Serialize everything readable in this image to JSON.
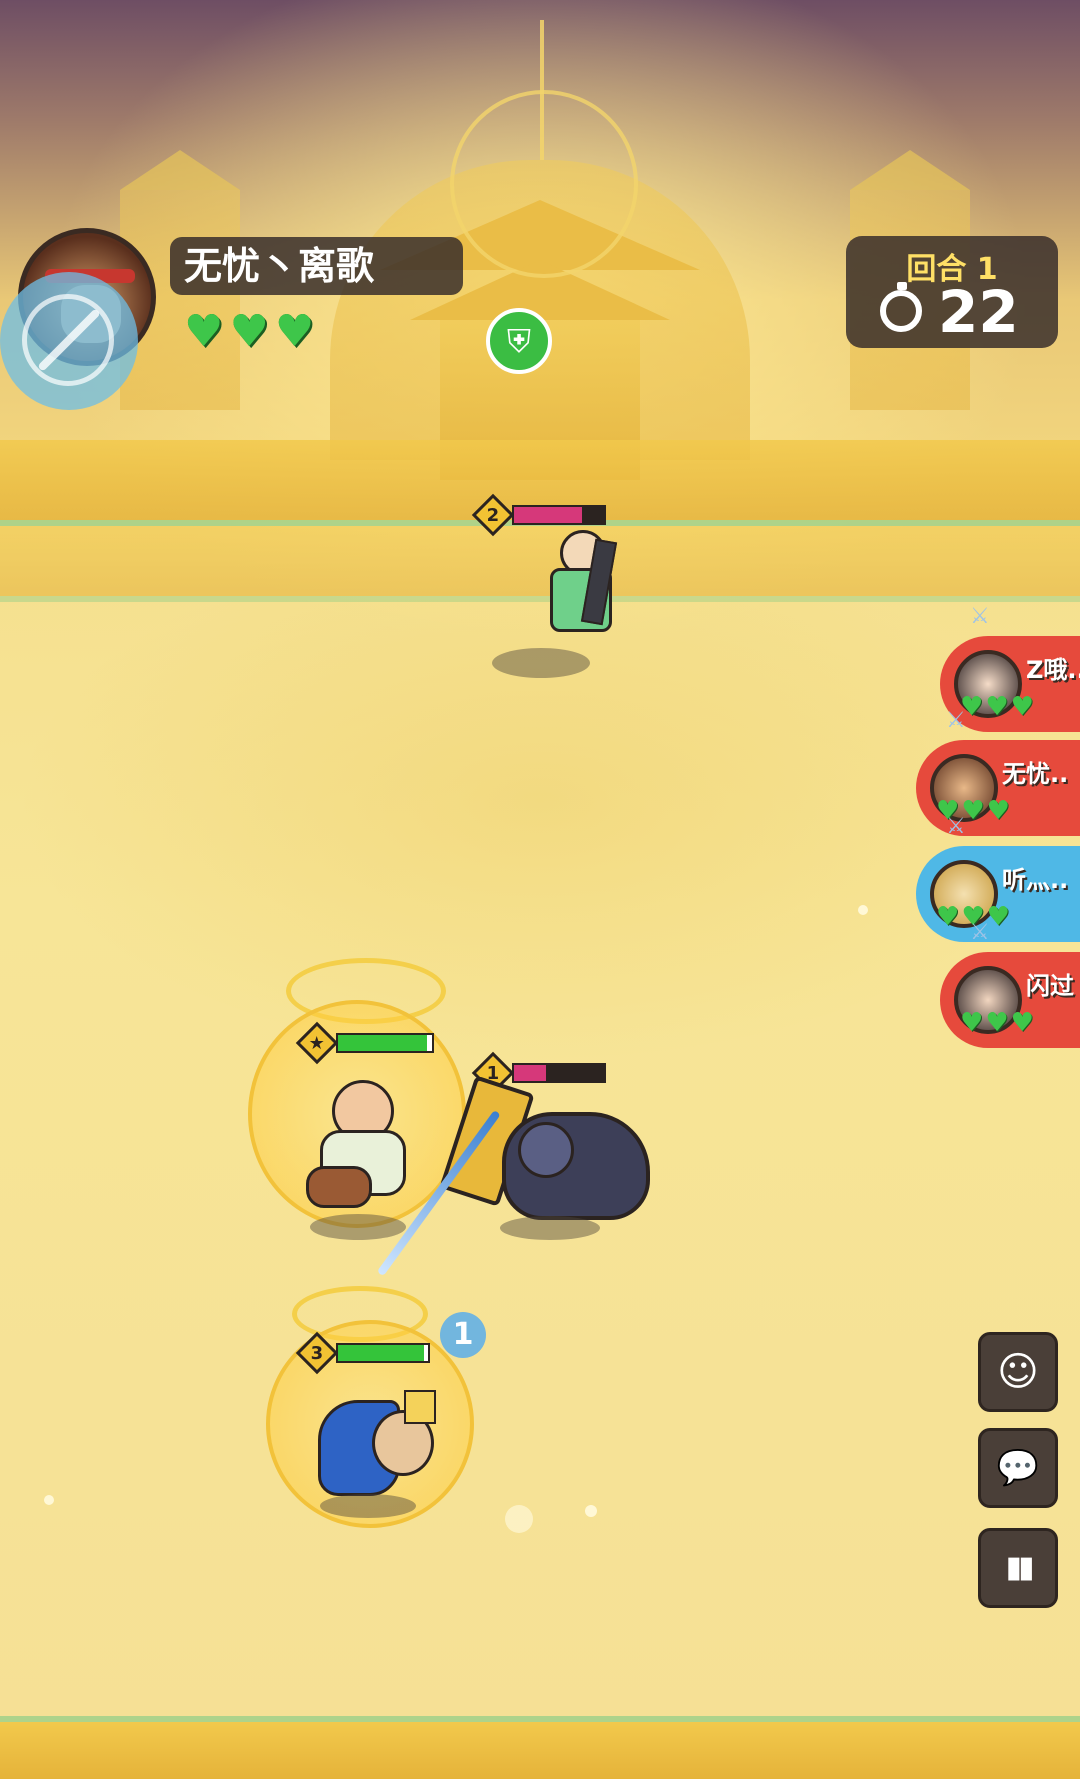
{
  "player": {
    "name": "无忧丶离歌",
    "lives": 3
  },
  "round": {
    "label": "回合 1",
    "timer": "22"
  },
  "units": [
    {
      "level": "2",
      "hp": 0.75,
      "color": "#d6387a"
    },
    {
      "level": "1",
      "hp": 0.35,
      "color": "#d6387a"
    },
    {
      "level": "3",
      "hp": 0.95,
      "color": "#34c43a"
    }
  ],
  "ally_leader": {
    "level": "★",
    "hp": 0.95,
    "color": "#34c43a"
  },
  "floating_number": "1",
  "opponents": [
    {
      "name": "Z哦..",
      "lives": 3,
      "color": "#e64a3c"
    },
    {
      "name": "无忧..",
      "lives": 3,
      "color": "#e64a3c"
    },
    {
      "name": "听灬..",
      "lives": 3,
      "color": "#4fb8e6"
    },
    {
      "name": "闪过",
      "lives": 3,
      "color": "#e64a3c"
    }
  ],
  "icons": {
    "heart": "♥",
    "shield": "shield-icon",
    "timer": "stopwatch-icon",
    "emoji": "smiley-icon",
    "chat": "chat-bubble-icon",
    "stats": "bar-chart-icon"
  },
  "side_buttons": {
    "emoji": "☺",
    "chat": "💬",
    "stats": "▮▮"
  },
  "shield_glyph": "⛨"
}
